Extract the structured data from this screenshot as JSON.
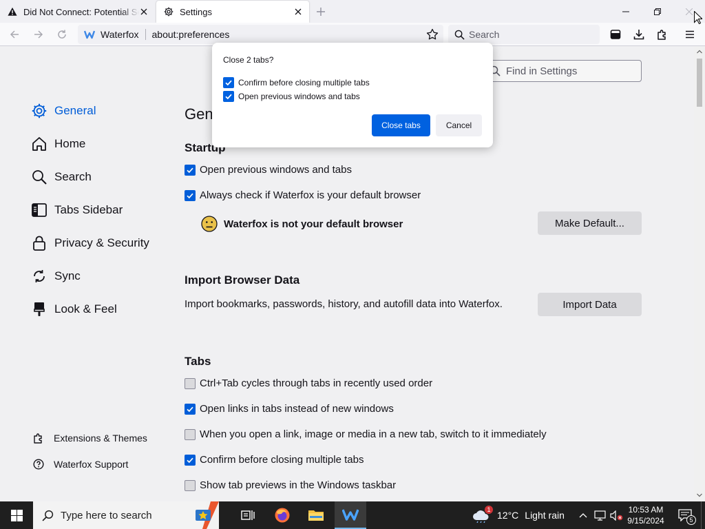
{
  "browser": {
    "tabs": [
      {
        "label": "Did Not Connect: Potential Security Issue",
        "icon": "warning-icon"
      },
      {
        "label": "Settings",
        "icon": "gear-icon"
      }
    ],
    "identity_label": "Waterfox",
    "url": "about:preferences",
    "search_placeholder": "Search"
  },
  "settings": {
    "find_placeholder": "Find in Settings",
    "page_title": "General",
    "categories": [
      {
        "label": "General",
        "icon": "gear-icon",
        "selected": true
      },
      {
        "label": "Home",
        "icon": "home-icon"
      },
      {
        "label": "Search",
        "icon": "search-icon"
      },
      {
        "label": "Tabs Sidebar",
        "icon": "sidebar-icon"
      },
      {
        "label": "Privacy & Security",
        "icon": "lock-icon"
      },
      {
        "label": "Sync",
        "icon": "sync-icon"
      },
      {
        "label": "Look & Feel",
        "icon": "brush-icon"
      }
    ],
    "footer_links": [
      {
        "label": "Extensions & Themes",
        "icon": "puzzle-icon"
      },
      {
        "label": "Waterfox Support",
        "icon": "help-icon"
      }
    ],
    "startup": {
      "heading": "Startup",
      "open_previous": {
        "label": "Open previous windows and tabs",
        "checked": true
      },
      "always_check": {
        "label": "Always check if Waterfox is your default browser",
        "checked": true
      },
      "not_default_text": "Waterfox is not your default browser",
      "make_default_button": "Make Default..."
    },
    "import": {
      "heading": "Import Browser Data",
      "description": "Import bookmarks, passwords, history, and autofill data into Waterfox.",
      "button": "Import Data"
    },
    "tabs_section": {
      "heading": "Tabs",
      "options": [
        {
          "label": "Ctrl+Tab cycles through tabs in recently used order",
          "checked": false
        },
        {
          "label": "Open links in tabs instead of new windows",
          "checked": true
        },
        {
          "label": "When you open a link, image or media in a new tab, switch to it immediately",
          "checked": false
        },
        {
          "label": "Confirm before closing multiple tabs",
          "checked": true
        },
        {
          "label": "Show tab previews in the Windows taskbar",
          "checked": false
        }
      ]
    }
  },
  "dialog": {
    "title": "Close 2 tabs?",
    "options": [
      {
        "label": "Confirm before closing multiple tabs",
        "checked": true
      },
      {
        "label": "Open previous windows and tabs",
        "checked": true
      }
    ],
    "primary_button": "Close tabs",
    "secondary_button": "Cancel"
  },
  "taskbar": {
    "search_placeholder": "Type here to search",
    "weather": {
      "temp": "12°C",
      "condition": "Light rain",
      "badge": "1"
    },
    "time": "10:53 AM",
    "date": "9/15/2024",
    "notification_count": "5"
  },
  "colors": {
    "accent": "#0061e0",
    "taskbar": "#1f1f1f"
  }
}
